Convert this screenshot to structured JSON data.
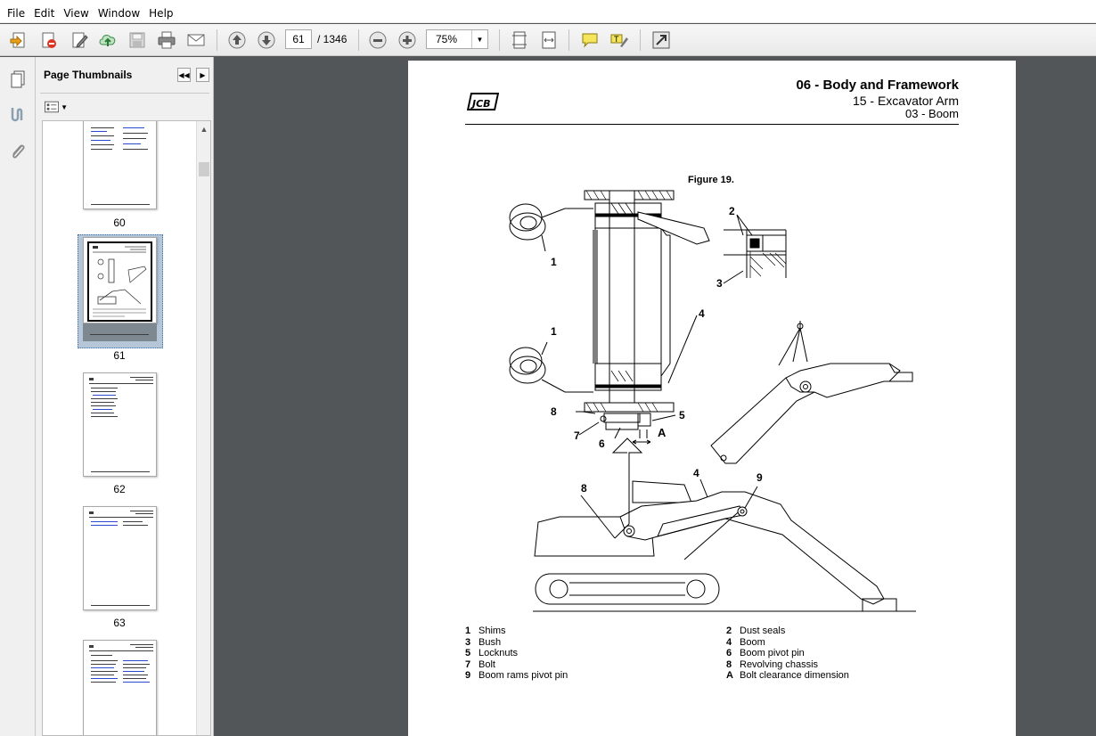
{
  "menu": [
    "File",
    "Edit",
    "View",
    "Window",
    "Help"
  ],
  "toolbar": {
    "page_current": "61",
    "page_total": "/ 1346",
    "zoom": "75%"
  },
  "thumbnails_panel": {
    "title": "Page Thumbnails",
    "pages": [
      "60",
      "61",
      "62",
      "63"
    ]
  },
  "document": {
    "section_title": "06 - Body and Framework",
    "subsection": "15 - Excavator Arm",
    "topic": "03 - Boom",
    "logo_text": "JCB",
    "figure_title": "Figure 19.",
    "callouts": [
      "1",
      "1",
      "2",
      "3",
      "4",
      "5",
      "6",
      "7",
      "8",
      "A",
      "8",
      "4",
      "9"
    ],
    "legend_left": [
      {
        "num": "1",
        "label": "Shims"
      },
      {
        "num": "3",
        "label": "Bush"
      },
      {
        "num": "5",
        "label": "Locknuts"
      },
      {
        "num": "7",
        "label": "Bolt"
      },
      {
        "num": "9",
        "label": "Boom rams pivot pin"
      }
    ],
    "legend_right": [
      {
        "num": "2",
        "label": "Dust seals"
      },
      {
        "num": "4",
        "label": "Boom"
      },
      {
        "num": "6",
        "label": "Boom pivot pin"
      },
      {
        "num": "8",
        "label": "Revolving chassis"
      },
      {
        "num": "A",
        "label": "Bolt clearance dimension"
      }
    ]
  },
  "colors": {
    "viewer_background": "#525659",
    "selection": "#b4c6d8",
    "panel": "#f0f0f0"
  }
}
